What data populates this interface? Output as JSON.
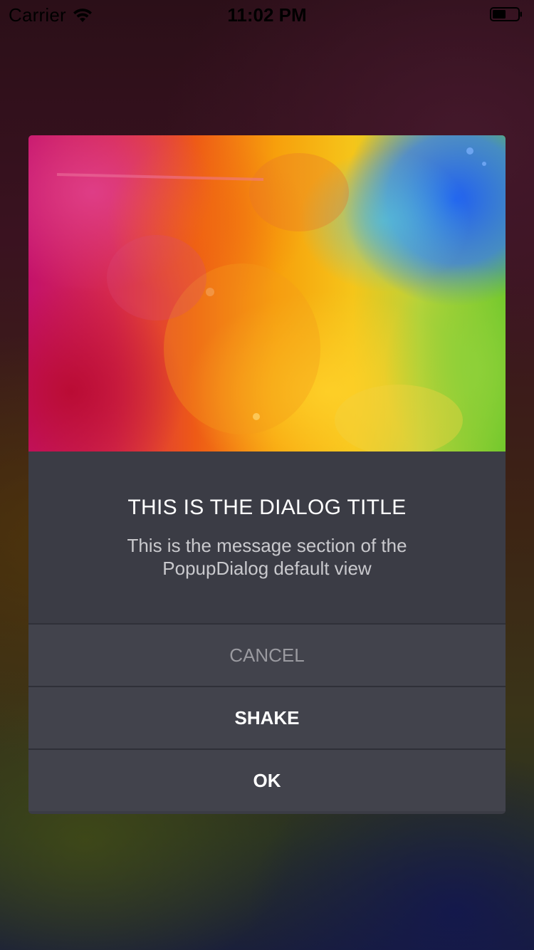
{
  "status_bar": {
    "carrier": "Carrier",
    "time": "11:02 PM",
    "wifi_icon": "wifi-icon",
    "battery_icon": "battery-icon"
  },
  "dialog": {
    "image": "watercolor-rainbow-image",
    "title": "THIS IS THE DIALOG TITLE",
    "message": "This is the message section of the PopupDialog default view",
    "buttons": {
      "cancel": "CANCEL",
      "shake": "SHAKE",
      "ok": "OK"
    },
    "colors": {
      "dialog_background": "#3b3c45",
      "button_background": "#42434c",
      "cancel_text": "#9a9aa0",
      "default_text": "#ffffff"
    }
  }
}
